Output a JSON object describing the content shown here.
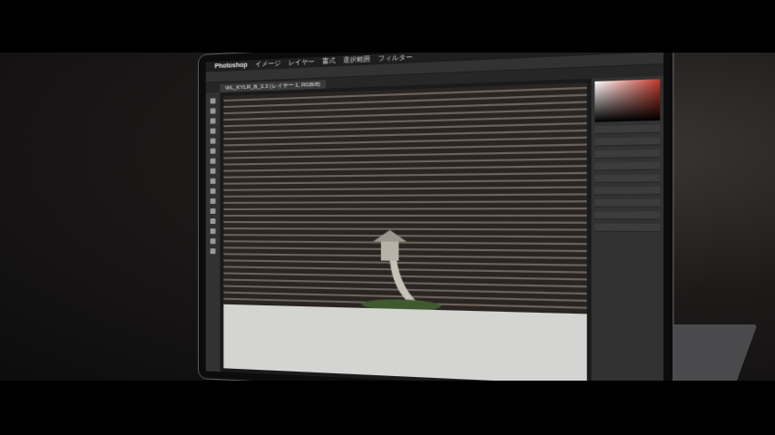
{
  "app": {
    "name": "Photoshop"
  },
  "menu": [
    "イメージ",
    "レイヤー",
    "書式",
    "選択範囲",
    "フィルター"
  ],
  "document_tab": {
    "title": "WL_KYLR_B_3.3 (レイヤー 1, RGB/8)",
    "selected": true
  }
}
